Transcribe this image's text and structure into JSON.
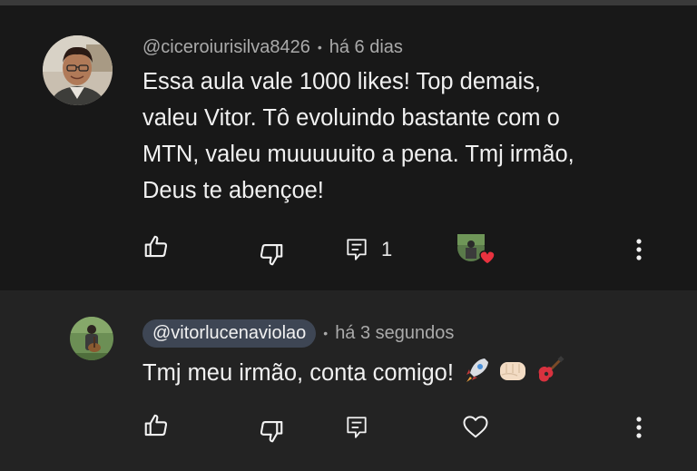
{
  "comments": [
    {
      "author": "@ciceroiurisilva8426",
      "separator": "•",
      "time": "há 6 dias",
      "text_lines": [
        "Essa aula vale 1000 likes! Top demais,",
        "valeu Vitor. Tô evoluindo bastante com o",
        "MTN, valeu muuuuuito a pena. Tmj irmão,",
        "Deus te abençoe!"
      ],
      "reply_count": "1",
      "icons": [
        "like-icon",
        "dislike-icon",
        "reply-icon",
        "creator-heart-badge",
        "more-icon"
      ]
    },
    {
      "author": "@vitorlucenaviolao",
      "separator": "•",
      "time": "há 3 segundos",
      "text": "Tmj meu irmão, conta comigo!",
      "emojis": [
        "rocket-emoji",
        "fist-emoji",
        "guitar-emoji"
      ],
      "icons": [
        "like-icon",
        "dislike-icon",
        "reply-icon",
        "heart-outline-icon",
        "more-icon"
      ]
    }
  ],
  "colors": {
    "background": "#181818",
    "reply_background": "#232323",
    "text": "#f1f1f1",
    "meta": "#aaaaaa",
    "creator_chip": "#3e4654",
    "heart": "#e8323f"
  }
}
